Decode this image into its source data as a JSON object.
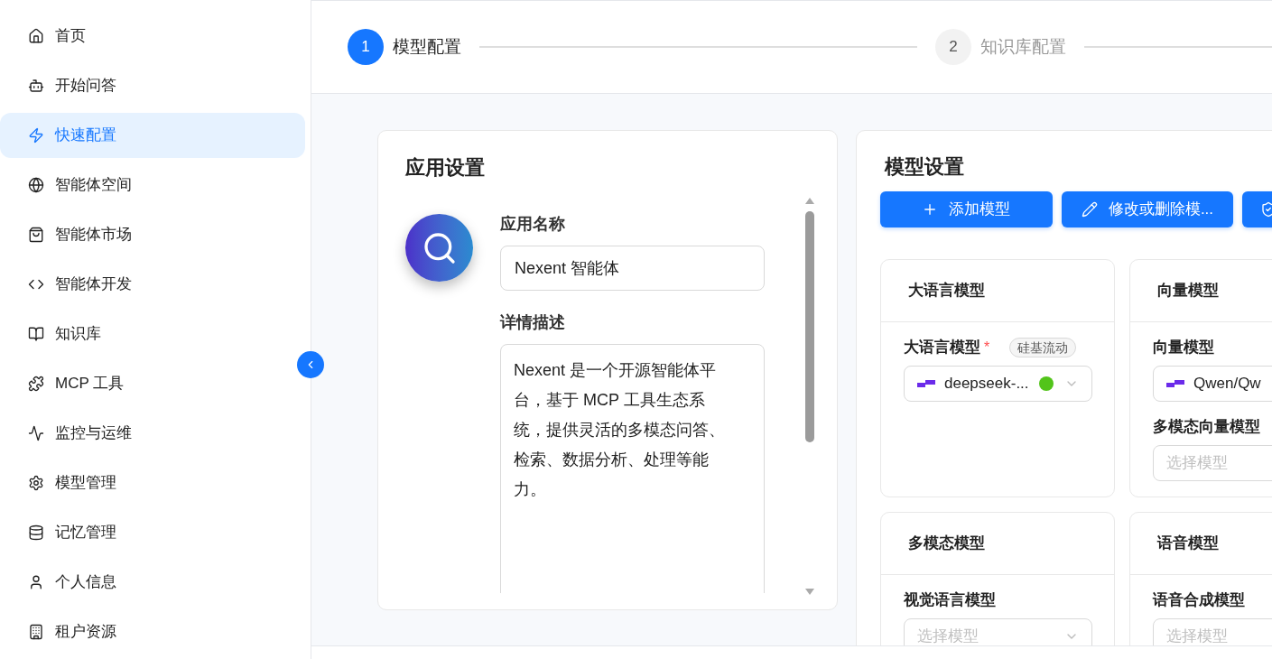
{
  "sidebar": {
    "items": [
      {
        "label": "首页",
        "selected": false
      },
      {
        "label": "开始问答",
        "selected": false
      },
      {
        "label": "快速配置",
        "selected": true
      },
      {
        "label": "智能体空间",
        "selected": false
      },
      {
        "label": "智能体市场",
        "selected": false
      },
      {
        "label": "智能体开发",
        "selected": false
      },
      {
        "label": "知识库",
        "selected": false
      },
      {
        "label": "MCP 工具",
        "selected": false
      },
      {
        "label": "监控与运维",
        "selected": false
      },
      {
        "label": "模型管理",
        "selected": false
      },
      {
        "label": "记忆管理",
        "selected": false
      },
      {
        "label": "个人信息",
        "selected": false
      },
      {
        "label": "租户资源",
        "selected": false
      }
    ]
  },
  "steps": [
    {
      "number": "1",
      "label": "模型配置",
      "selected": true
    },
    {
      "number": "2",
      "label": "知识库配置",
      "selected": false
    }
  ],
  "app_settings": {
    "title": "应用设置",
    "name_label": "应用名称",
    "name_value": "Nexent 智能体",
    "description_label": "详情描述",
    "description_value": "Nexent 是一个开源智能体平台，基于 MCP 工具生态系统，提供灵活的多模态问答、检索、数据分析、处理等能力。"
  },
  "model_settings": {
    "title": "模型设置",
    "buttons": [
      {
        "kind": "add",
        "label": "添加模型"
      },
      {
        "kind": "edit",
        "label": "修改或删除模..."
      },
      {
        "kind": "verify"
      }
    ],
    "groups": [
      {
        "title": "大语言模型",
        "fields": [
          {
            "label": "大语言模型",
            "required_mark": "*",
            "tag": "硅基流动",
            "value": "deepseek-...",
            "color": "#52c41a",
            "chevron": true
          }
        ]
      },
      {
        "title": "向量模型",
        "fields": [
          {
            "label": "向量模型",
            "value": "Qwen/Qw"
          },
          {
            "label": "多模态向量模型",
            "placeholder": "选择模型"
          }
        ]
      },
      {
        "title": "多模态模型",
        "fields": [
          {
            "label": "视觉语言模型",
            "placeholder": "选择模型",
            "chevron": true
          }
        ]
      },
      {
        "title": "语音模型",
        "fields": [
          {
            "label": "语音合成模型",
            "placeholder": "选择模型"
          }
        ]
      }
    ]
  }
}
